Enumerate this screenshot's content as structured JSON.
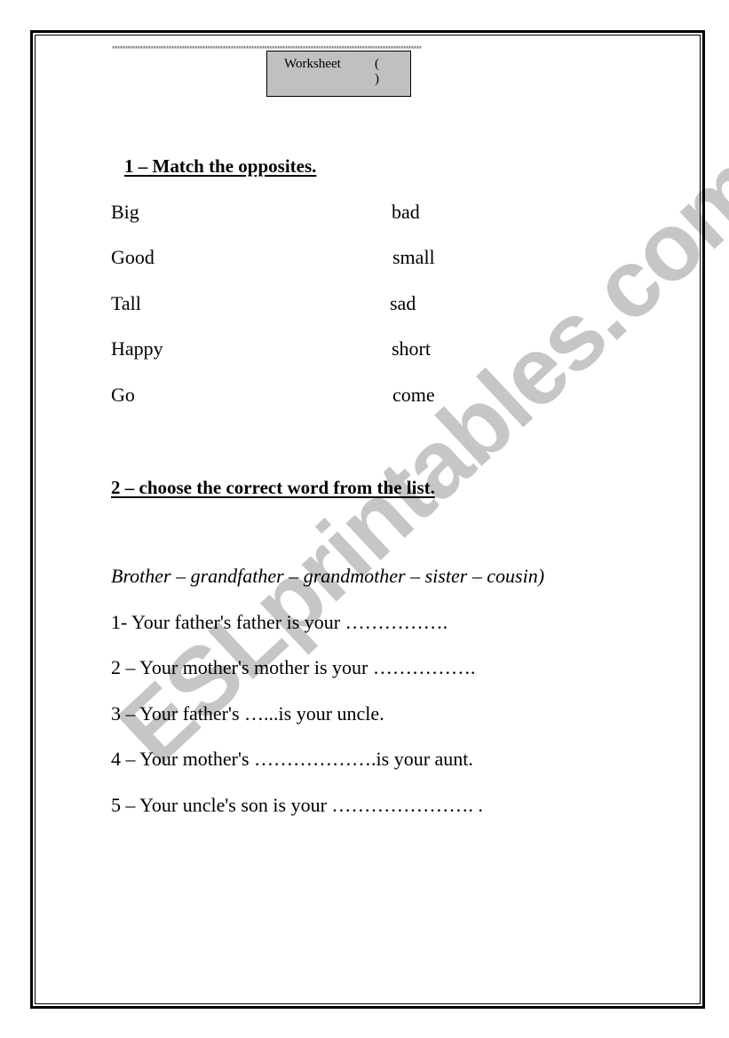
{
  "header": {
    "stars_line": "************************************************************************************************************************",
    "worksheet_label": "Worksheet",
    "worksheet_number": "( )"
  },
  "section1": {
    "heading": "1 – Match the opposites.",
    "left_words": [
      "Big",
      "Good",
      "Tall",
      "Happy",
      "Go"
    ],
    "right_words": [
      "bad",
      "small",
      "sad",
      "short",
      "come"
    ]
  },
  "section2": {
    "heading": "2 – choose the correct word from the list.",
    "word_list": "Brother – grandfather – grandmother – sister – cousin)",
    "questions": [
      "1- Your father's  father is your …………….",
      "2 – Your mother's mother is your …………….",
      "3 – Your father's …...is your uncle.",
      "4 – Your mother's ……………….is your aunt.",
      "5 – Your uncle's son is your …………………. ."
    ]
  },
  "watermark": {
    "text": "ESLprintables.com",
    "color": "#c6c6c6"
  }
}
